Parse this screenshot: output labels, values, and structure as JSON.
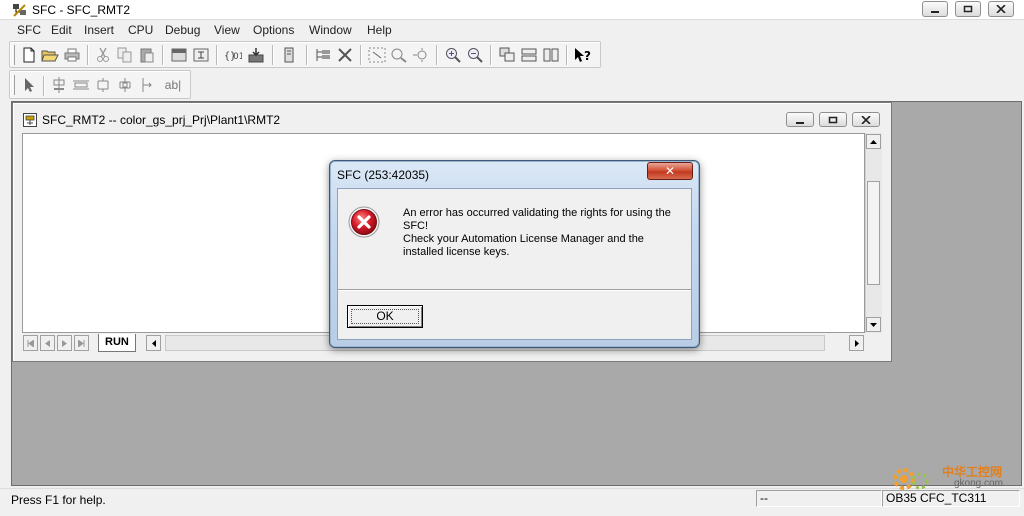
{
  "window": {
    "title": "SFC - SFC_RMT2"
  },
  "menu": [
    "SFC",
    "Edit",
    "Insert",
    "CPU",
    "Debug",
    "View",
    "Options",
    "Window",
    "Help"
  ],
  "child_window": {
    "title": "SFC_RMT2 -- color_gs_prj_Prj\\Plant1\\RMT2",
    "tab_label": "RUN"
  },
  "text_tool": {
    "label": "ab|"
  },
  "dialog": {
    "title": "SFC (253:42035)",
    "message": "An error has occurred validating the rights for using the SFC!\nCheck your Automation License Manager and the installed license keys.",
    "ok_label": "OK",
    "close_glyph": "✕"
  },
  "status": {
    "help_text": "Press F1 for help.",
    "pane_mode": "--",
    "pane_location": "OB35  CFC_TC311"
  },
  "watermark": {
    "brand": "中华工控网",
    "domain": "gkong.com"
  },
  "colors": {
    "error_red": "#c8102e",
    "dialog_frame": "#c5d8ee",
    "mdi_background": "#a9a9a9"
  }
}
